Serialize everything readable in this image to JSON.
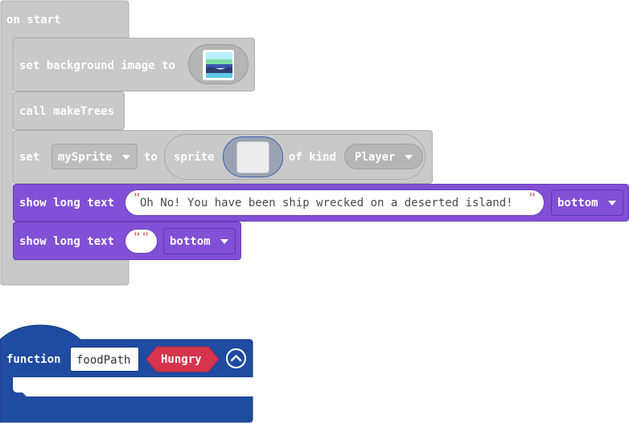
{
  "on_start": {
    "hat_label": "on start",
    "set_bg": {
      "label": "set background image to",
      "image_icon": "background-image-icon"
    },
    "call": {
      "label": "call makeTrees"
    },
    "set_sprite": {
      "set_label": "set",
      "variable": "mySprite",
      "to_label": "to",
      "sprite_label": "sprite",
      "image_icon": "sprite-image-icon",
      "of_kind_label": "of kind",
      "kind": "Player"
    },
    "show_text_1": {
      "label": "show long text",
      "text": "Oh No! You have been ship wrecked on a deserted island!",
      "position": "bottom"
    },
    "show_text_2": {
      "label": "show long text",
      "text": "",
      "position": "bottom"
    }
  },
  "function_block": {
    "label": "function",
    "name": "foodPath",
    "param": "Hungry",
    "collapse_icon": "chevron-up-circle-icon"
  },
  "colors": {
    "grey_block": "#c9c9c9",
    "purple_block": "#8250d6",
    "function_blue": "#1f4ba0",
    "param_red": "#d6344d"
  }
}
